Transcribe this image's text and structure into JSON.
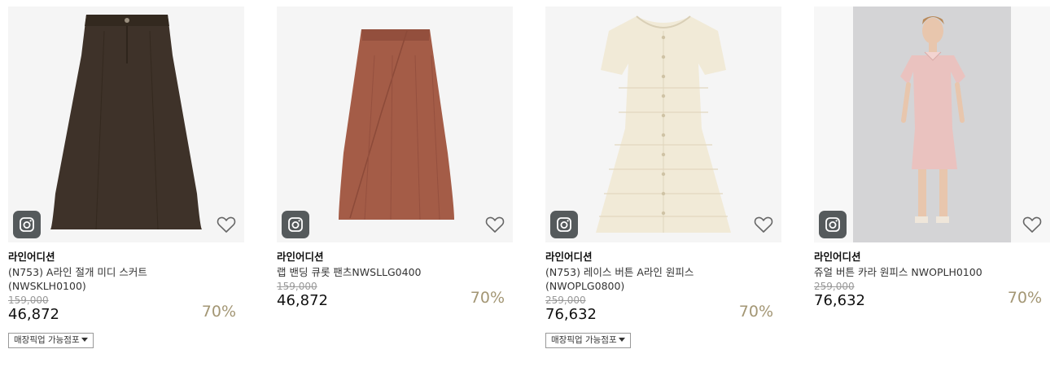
{
  "products": [
    {
      "brand": "라인어디션",
      "name": "(N753) A라인 절개 미디 스커트\n(NWSKLH0100)",
      "original_price": "159,000",
      "price": "46,872",
      "discount": "70%",
      "pickup_label": "매장픽업 가능점포",
      "has_pickup": true
    },
    {
      "brand": "라인어디션",
      "name": "랩 밴딩 큐롯 팬츠NWSLLG0400",
      "original_price": "159,000",
      "price": "46,872",
      "discount": "70%",
      "has_pickup": false
    },
    {
      "brand": "라인어디션",
      "name": "(N753) 레이스 버튼 A라인 원피스\n(NWOPLG0800)",
      "original_price": "259,000",
      "price": "76,632",
      "discount": "70%",
      "pickup_label": "매장픽업 가능점포",
      "has_pickup": true
    },
    {
      "brand": "라인어디션",
      "name": "쥬얼 버튼 카라 원피스 NWOPLH0100",
      "original_price": "259,000",
      "price": "76,632",
      "discount": "70%",
      "has_pickup": false
    }
  ],
  "colors": {
    "discount": "#a39674",
    "skirt_brown": "#3e3229",
    "culotte_rust": "#a45c47",
    "dress_cream": "#f1ead7",
    "dress_pink": "#eac2bf",
    "instagram_badge": "#555a5c"
  },
  "icons": {
    "instagram": "instagram-icon",
    "wishlist": "heart-icon",
    "dropdown": "caret-down-icon"
  }
}
